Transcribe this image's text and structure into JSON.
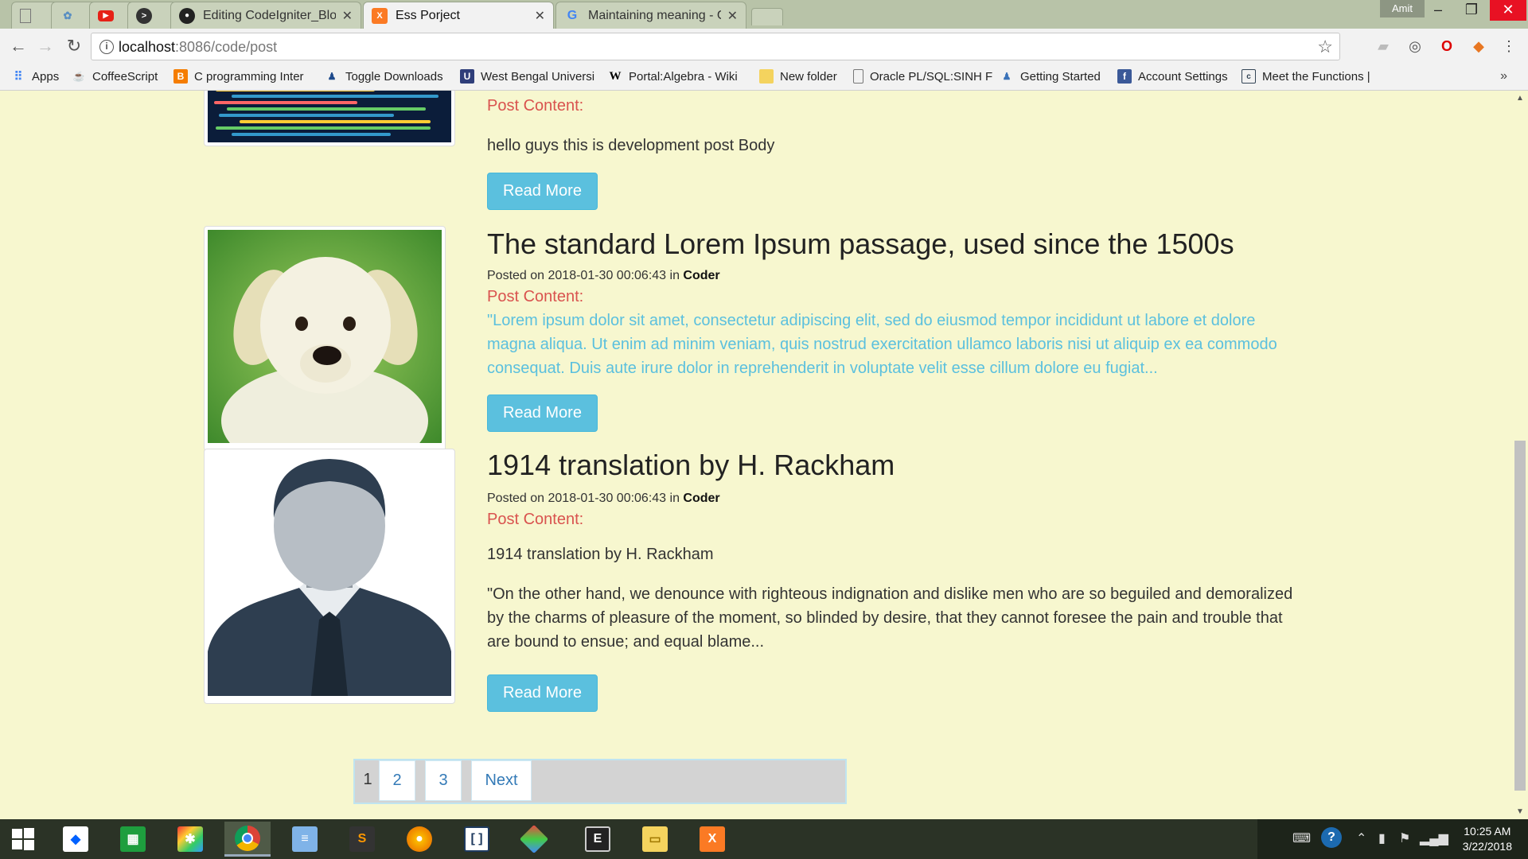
{
  "browser": {
    "tabs": [
      {
        "title": "",
        "icon": "blank-page-icon"
      },
      {
        "title": "",
        "icon": "app-icon"
      },
      {
        "title": "",
        "icon": "youtube-icon"
      },
      {
        "title": "",
        "icon": "terminal-icon"
      },
      {
        "title": "Editing CodeIgniter_Blog",
        "icon": "github-icon"
      },
      {
        "title": "Ess Porject",
        "icon": "xampp-icon"
      },
      {
        "title": "Maintaining meaning - G",
        "icon": "google-icon"
      }
    ],
    "user": "Amit",
    "url_host": "localhost",
    "url_path": ":8086/code/post",
    "bookmarks": [
      {
        "label": "Apps",
        "icon": "apps-grid-icon",
        "color": "#4285f4"
      },
      {
        "label": "CoffeeScript",
        "icon": "coffee-icon",
        "color": "#333333"
      },
      {
        "label": "C programming Inter",
        "icon": "blogger-icon",
        "color": "#f57d00"
      },
      {
        "label": "Toggle Downloads",
        "icon": "person-icon",
        "color": "#1e4a8c"
      },
      {
        "label": "West Bengal Universi",
        "icon": "university-icon",
        "color": "#2f3e7a"
      },
      {
        "label": "Portal:Algebra - Wiki",
        "icon": "wikipedia-icon",
        "color": "#000000"
      },
      {
        "label": "New folder",
        "icon": "folder-icon",
        "color": "#f4d35e"
      },
      {
        "label": "Oracle PL/SQL:SINH F",
        "icon": "page-icon",
        "color": "#777777"
      },
      {
        "label": "Getting Started",
        "icon": "user-icon",
        "color": "#3b73b9"
      },
      {
        "label": "Account Settings",
        "icon": "facebook-icon",
        "color": "#3b5998"
      },
      {
        "label": "Meet the Functions |",
        "icon": "doc-icon",
        "color": "#345"
      }
    ]
  },
  "posts": [
    {
      "label": "Post Content:",
      "body": "hello guys  this is development post Body",
      "button": "Read More"
    },
    {
      "title": "The standard Lorem Ipsum passage, used since the 1500s",
      "meta_prefix": "Posted on 2018-01-30 00:06:43 in ",
      "category": "Coder",
      "label": "Post Content:",
      "body": "\"Lorem ipsum dolor sit amet, consectetur adipiscing elit, sed do eiusmod tempor incididunt ut labore et dolore magna aliqua. Ut enim ad minim veniam, quis nostrud exercitation ullamco laboris nisi ut aliquip ex ea commodo consequat. Duis aute irure dolor in reprehenderit in voluptate velit esse cillum dolore eu fugiat...",
      "button": "Read More"
    },
    {
      "title": "1914 translation by H. Rackham",
      "meta_prefix": "Posted on 2018-01-30 00:06:43 in ",
      "category": "Coder",
      "label": "Post Content:",
      "subtitle": "1914 translation by H. Rackham",
      "body": "\"On the other hand, we denounce with righteous indignation and dislike men who are so beguiled and demoralized by the charms of pleasure of the moment, so blinded by desire, that they cannot foresee the pain and trouble that are bound to ensue; and equal blame...",
      "button": "Read More"
    }
  ],
  "pagination": {
    "current": "1",
    "pages": [
      "2",
      "3"
    ],
    "next": "Next"
  },
  "taskbar": {
    "time": "10:25 AM",
    "date": "3/22/2018"
  },
  "colors": {
    "page_bg": "#f7f7cf",
    "button": "#5bc0de",
    "label": "#d9534f"
  }
}
